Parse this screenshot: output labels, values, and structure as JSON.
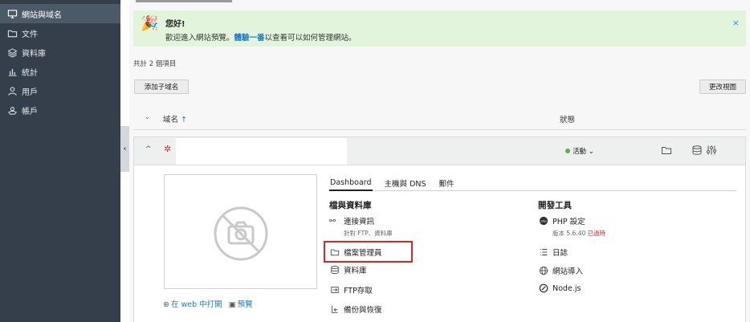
{
  "sidebar": {
    "items": [
      {
        "label": "網站與域名",
        "icon": "monitor-icon",
        "active": true
      },
      {
        "label": "文件",
        "icon": "folder-icon"
      },
      {
        "label": "資料庫",
        "icon": "database-icon"
      },
      {
        "label": "統計",
        "icon": "chart-icon"
      },
      {
        "label": "用戶",
        "icon": "user-icon"
      },
      {
        "label": "帳戶",
        "icon": "account-icon"
      }
    ]
  },
  "banner": {
    "title": "您好!",
    "msg_before": "歡迎進入網站預覽。",
    "msg_link": "體驗一番",
    "msg_after": "以查看可以如何管理網站。",
    "close": "×"
  },
  "count_text": "共計 2 個項目",
  "buttons": {
    "add_subdomain": "添加子域名",
    "change_view": "更改視圖"
  },
  "table": {
    "col_domain": "域名",
    "col_domain_arrow": "↑",
    "col_status": "狀態"
  },
  "domain": {
    "status": "活動"
  },
  "tabs": [
    {
      "label": "Dashboard",
      "active": true
    },
    {
      "label": "主機與 DNS"
    },
    {
      "label": "郵件"
    }
  ],
  "files_section": {
    "title": "檔與資料庫",
    "items": [
      {
        "label": "連接資訊",
        "sub": "針對 FTP、資料庫",
        "icon": "connection-icon"
      },
      {
        "label": "檔案管理員",
        "icon": "folder-icon"
      },
      {
        "label": "資料庫",
        "icon": "database-icon"
      },
      {
        "label": "FTP存取",
        "icon": "ftp-icon"
      },
      {
        "label": "備份與恢復",
        "icon": "backup-icon"
      }
    ]
  },
  "dev_section": {
    "title": "開發工具",
    "items": [
      {
        "label": "PHP 設定",
        "sub": "版本 5.6.40",
        "sub_warn": "已過時",
        "icon": "php-icon"
      },
      {
        "label": "日誌",
        "icon": "logs-icon"
      },
      {
        "label": "網站導入",
        "icon": "globe-icon"
      },
      {
        "label": "Node.js",
        "icon": "nodejs-icon"
      }
    ]
  },
  "preview_links": {
    "open_web": "在 web 中打開",
    "preview": "預覽"
  },
  "colors": {
    "sidebar_bg": "#343f4b",
    "accent": "#1d7ac2",
    "banner_bg": "#e3f4dc",
    "highlight": "#e02424",
    "status_green": "#5fb13a"
  }
}
